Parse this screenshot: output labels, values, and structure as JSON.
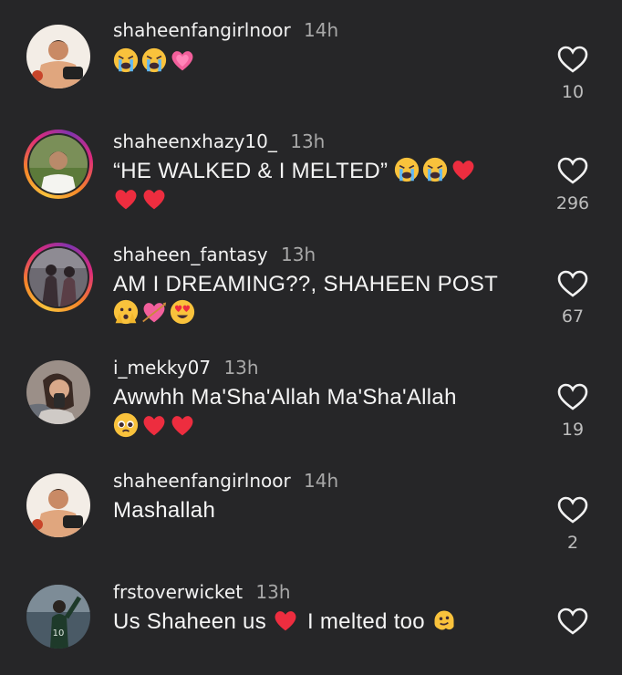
{
  "comments": [
    {
      "username": "shaheenfangirlnoor",
      "time": "14h",
      "text": "",
      "emojis": [
        "crying-face",
        "crying-face",
        "growing-heart"
      ],
      "likes": "10"
    },
    {
      "username": "shaheenxhazy10_",
      "time": "13h",
      "text": "“HE WALKED & I MELTED”",
      "emojis": [
        "crying-face",
        "crying-face",
        "red-heart",
        "red-heart",
        "red-heart"
      ],
      "likes": "296"
    },
    {
      "username": "shaheen_fantasy",
      "time": "13h",
      "text": "AM I DREAMING??, SHAHEEN POST",
      "emojis": [
        "face-peeking",
        "heart-with-arrow",
        "heart-eyes"
      ],
      "likes": "67"
    },
    {
      "username": "i_mekky07",
      "time": "13h",
      "text": "Awwhh Ma'Sha'Allah Ma'Sha'Allah",
      "emojis": [
        "pleading-face",
        "red-heart",
        "red-heart"
      ],
      "likes": "19"
    },
    {
      "username": "shaheenfangirlnoor",
      "time": "14h",
      "text": "Mashallah",
      "emojis": [],
      "likes": "2"
    },
    {
      "username": "frstoverwicket",
      "time": "13h",
      "text_before": "Us Shaheen us",
      "text_after": "I melted too",
      "emojis": [
        "red-heart",
        "melting-face"
      ],
      "likes": ""
    }
  ],
  "icons": {
    "like": "heart-outline-icon"
  },
  "colors": {
    "background": "#262628",
    "text": "#f2f2f2",
    "secondary": "#a8a8a8",
    "heart": "#ed2d3f",
    "emoji_yellow": "#f9c23c"
  }
}
